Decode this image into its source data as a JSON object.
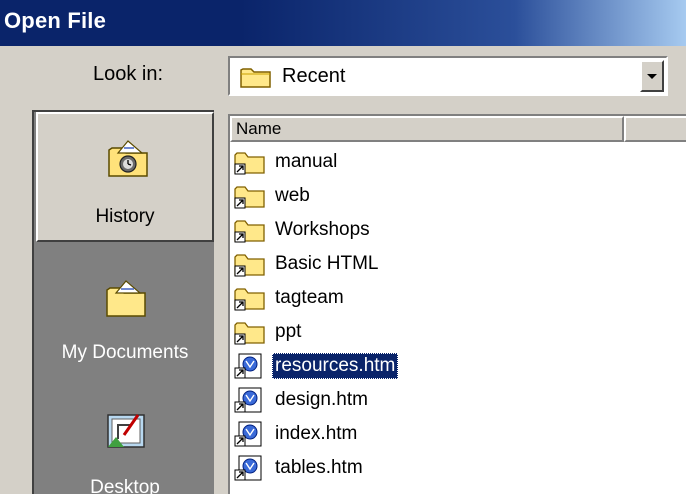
{
  "window": {
    "title": "Open File"
  },
  "look_in": {
    "label": "Look in:",
    "value": "Recent",
    "icon": "folder-icon"
  },
  "places": [
    {
      "label": "History",
      "icon": "history-icon",
      "selected": true
    },
    {
      "label": "My Documents",
      "icon": "my-documents-icon",
      "selected": false
    },
    {
      "label": "Desktop",
      "icon": "desktop-icon",
      "selected": false
    }
  ],
  "file_list": {
    "columns": [
      "Name",
      ""
    ],
    "items": [
      {
        "name": "manual",
        "type": "folder-shortcut",
        "selected": false
      },
      {
        "name": "web",
        "type": "folder-shortcut",
        "selected": false
      },
      {
        "name": "Workshops",
        "type": "folder-shortcut",
        "selected": false
      },
      {
        "name": "Basic HTML",
        "type": "folder-shortcut",
        "selected": false
      },
      {
        "name": "tagteam",
        "type": "folder-shortcut",
        "selected": false
      },
      {
        "name": "ppt",
        "type": "folder-shortcut",
        "selected": false
      },
      {
        "name": "resources.htm",
        "type": "html-shortcut",
        "selected": true
      },
      {
        "name": "design.htm",
        "type": "html-shortcut",
        "selected": false
      },
      {
        "name": "index.htm",
        "type": "html-shortcut",
        "selected": false
      },
      {
        "name": "tables.htm",
        "type": "html-shortcut",
        "selected": false
      }
    ]
  }
}
